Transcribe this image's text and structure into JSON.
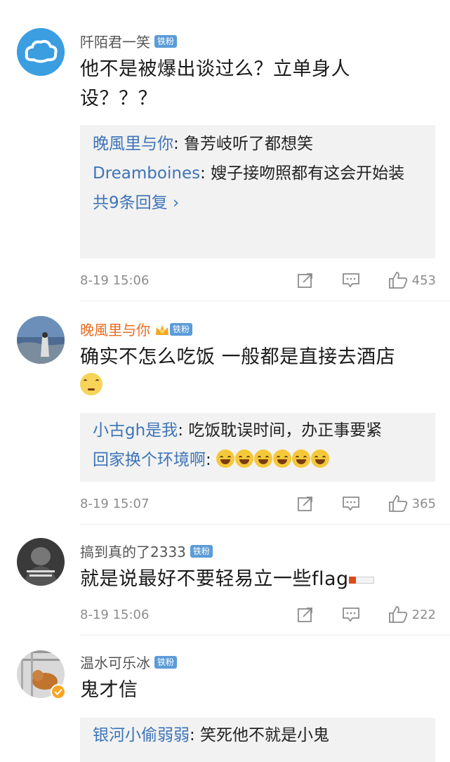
{
  "comments": [
    {
      "user": "阡陌君一笑",
      "badge": "铁粉",
      "text": "他不是被爆出谈过么？立单身人设？？？",
      "replies": [
        {
          "name": "晚風里与你",
          "text": ": 鲁芳岐听了都想笑"
        },
        {
          "name": "Dreamboines",
          "text": ": 嫂子接吻照都有这会开始装"
        }
      ],
      "more": "共9条回复 ›",
      "time": "8-19 15:06",
      "likes": "453"
    },
    {
      "user": "晚風里与你",
      "badge": "铁粉",
      "text": "确实不怎么吃饭 一般都是直接去酒店",
      "replies": [
        {
          "name": "小古gh是我",
          "text": ": 吃饭耽误时间，办正事要紧"
        },
        {
          "name": "回家换个环境啊",
          "text": ": "
        }
      ],
      "time": "8-19 15:07",
      "likes": "365"
    },
    {
      "user": "搞到真的了2333",
      "badge": "铁粉",
      "text": "就是说最好不要轻易立一些flag",
      "time": "8-19 15:06",
      "likes": "222"
    },
    {
      "user": "温水可乐冰",
      "badge": "铁粉",
      "text": "鬼才信",
      "replies": [
        {
          "name": "银河小偷弱弱",
          "text": ": 笑死他不就是小鬼"
        }
      ]
    }
  ],
  "colors": {
    "link_blue": "#3d74b8",
    "vip_orange": "#e86b1f",
    "badge_blue": "#5b9bd8",
    "meta_gray": "#8c8c8c",
    "reply_bg": "#f2f2f2"
  },
  "icons": [
    "forward-icon",
    "comment-icon",
    "like-icon",
    "laugh-cry-emoji",
    "pleading-emoji",
    "cigarette-emoji",
    "crown-icon"
  ]
}
